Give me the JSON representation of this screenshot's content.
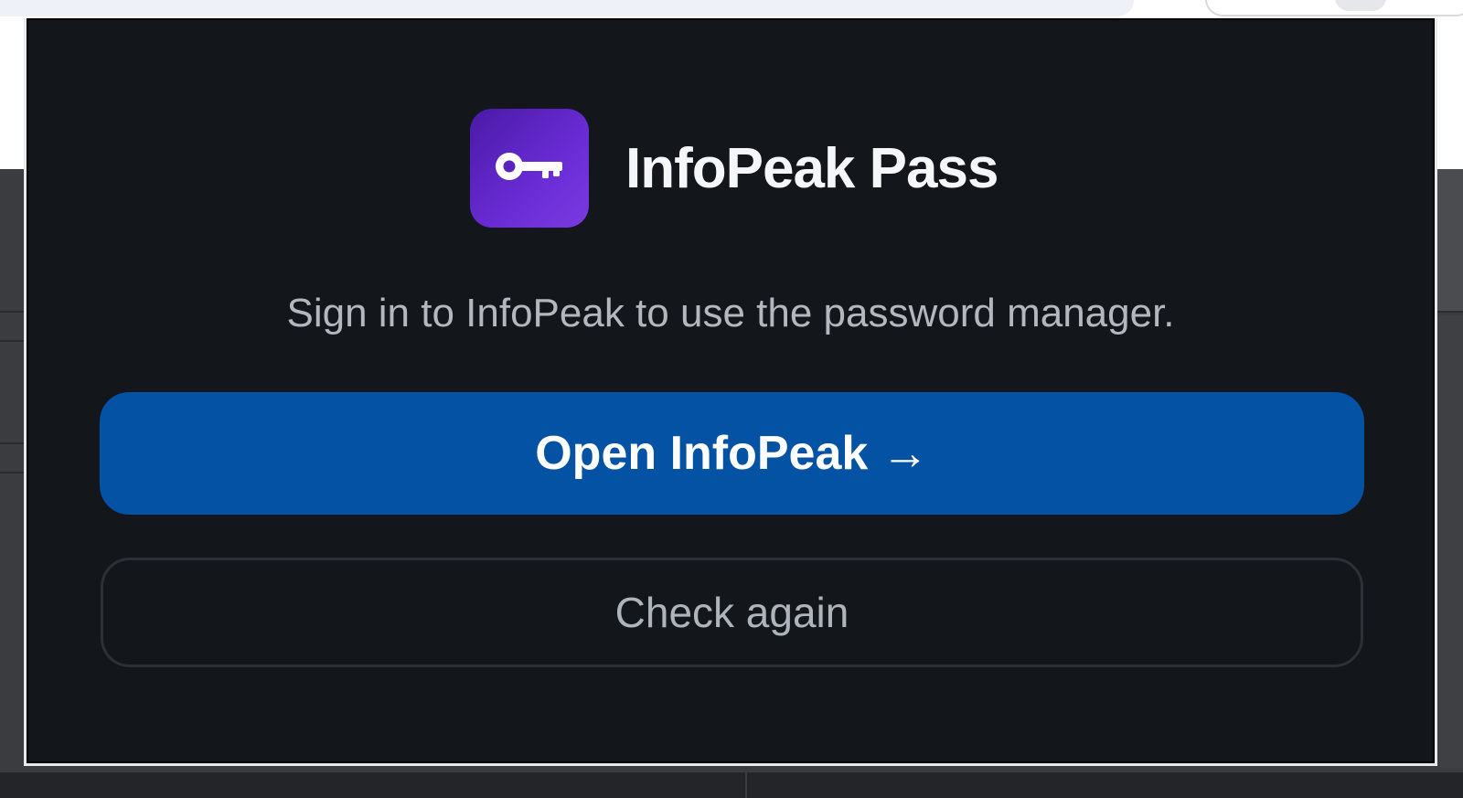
{
  "popup": {
    "app_name": "InfoPeak Pass",
    "logo_icon": "key-icon",
    "message": "Sign in to InfoPeak to use the password manager.",
    "primary_button_label": "Open InfoPeak →",
    "secondary_button_label": "Check again"
  },
  "colors": {
    "popup_background": "#13161a",
    "primary_button": "#0352a3",
    "logo_gradient_start": "#4a1aa6",
    "logo_gradient_end": "#7a3ae0"
  }
}
